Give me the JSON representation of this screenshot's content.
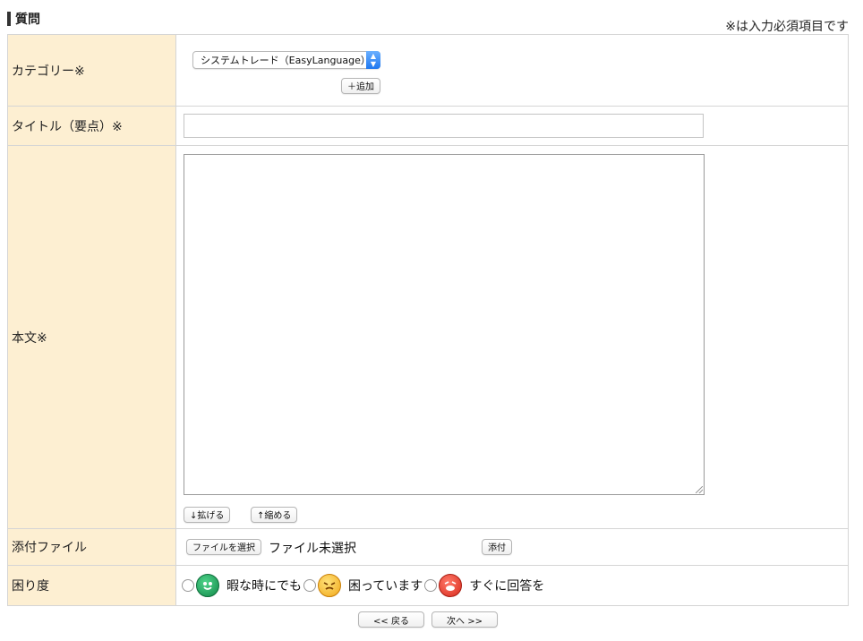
{
  "section": {
    "title": "質問",
    "required_note": "※は入力必須項目です"
  },
  "category": {
    "label": "カテゴリー※",
    "selected": "システムトレード（EasyLanguage）",
    "add_button": "＋追加"
  },
  "title_field": {
    "label": "タイトル（要点）※",
    "value": ""
  },
  "body_field": {
    "label": "本文※",
    "value": "",
    "expand_button": "↓拡げる",
    "shrink_button": "↑縮める"
  },
  "attachment": {
    "label": "添付ファイル",
    "choose_button": "ファイルを選択",
    "status": "ファイル未選択",
    "attach_button": "添付"
  },
  "urgency": {
    "label": "困り度",
    "options": [
      {
        "label": "暇な時にでも",
        "icon": "green-smiley-icon",
        "color": "#12894a"
      },
      {
        "label": "困っています",
        "icon": "yellow-troubled-icon",
        "color": "#f1a81a"
      },
      {
        "label": "すぐに回答を",
        "icon": "red-urgent-icon",
        "color": "#d82a1c"
      }
    ]
  },
  "nav": {
    "back_button": "<< 戻る",
    "next_button": "次へ >>"
  }
}
